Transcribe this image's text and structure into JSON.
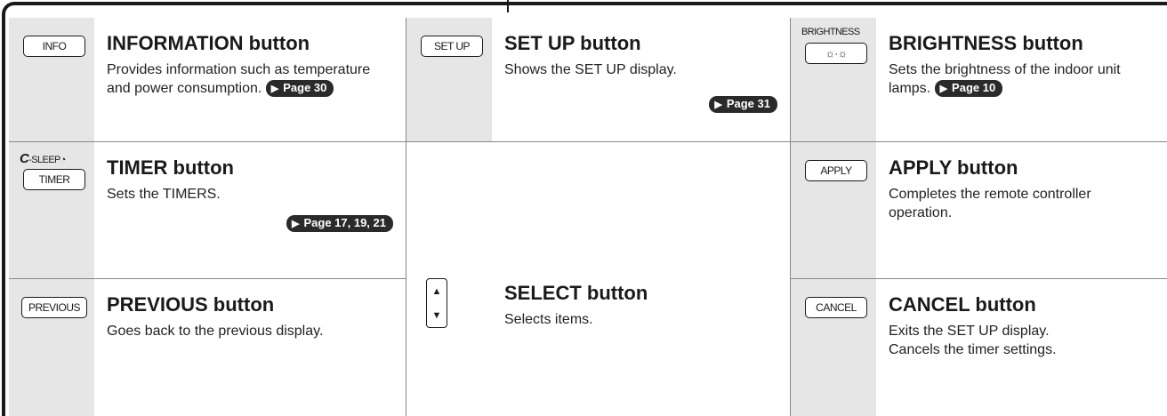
{
  "buttons": {
    "info": {
      "icon_label": "INFO",
      "title": "INFORMATION button",
      "description": "Provides information such as temperature and power consumption.",
      "page_ref": "Page 30"
    },
    "setup": {
      "icon_label": "SET UP",
      "title": "SET UP button",
      "description": "Shows the SET UP display.",
      "page_ref": "Page 31"
    },
    "brightness": {
      "icon_caption": "BRIGHTNESS",
      "icon_glyph": "☼·☼",
      "title": "BRIGHTNESS button",
      "description": "Sets the brightness of the indoor unit lamps.",
      "page_ref": "Page 10"
    },
    "timer": {
      "icon_caption_prefix": "C",
      "icon_caption_rest": "-SLEEP",
      "icon_caption_symbol": "◔",
      "icon_label": "TIMER",
      "title": "TIMER button",
      "description": "Sets the TIMERS.",
      "page_ref": "Page 17, 19, 21"
    },
    "select": {
      "up_arrow": "▲",
      "down_arrow": "▼",
      "title": "SELECT button",
      "description": "Selects items."
    },
    "apply": {
      "icon_label": "APPLY",
      "title": "APPLY button",
      "description": "Completes the remote controller operation."
    },
    "previous": {
      "icon_label": "PREVIOUS",
      "title": "PREVIOUS button",
      "description": "Goes back to the previous display."
    },
    "cancel": {
      "icon_label": "CANCEL",
      "title": "CANCEL button",
      "description_line1": "Exits the SET UP display.",
      "description_line2": "Cancels the timer settings."
    }
  },
  "symbols": {
    "page_arrow": "▶"
  },
  "colors": {
    "icon_bg": "#e6e6e6",
    "pill_bg": "#2a2a2a",
    "border": "#1a1a1a"
  }
}
